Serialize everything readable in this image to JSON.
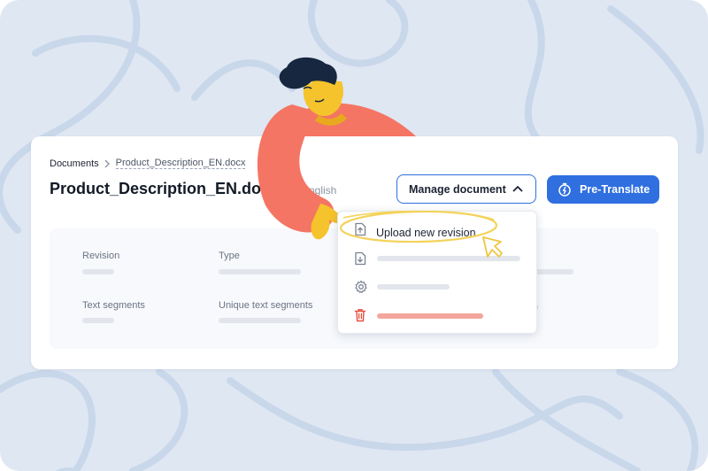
{
  "breadcrumb": {
    "root": "Documents",
    "current": "Product_Description_EN.docx"
  },
  "document": {
    "title": "Product_Description_EN.docx",
    "language": "English"
  },
  "buttons": {
    "manage": "Manage document",
    "pretranslate": "Pre-Translate"
  },
  "fields": [
    {
      "label": "Revision"
    },
    {
      "label": "Type"
    },
    {
      "label": "Text segments"
    },
    {
      "label": "Unique text segments"
    }
  ],
  "menu": {
    "items": [
      {
        "label": "Upload new revision",
        "icon": "upload-file-icon"
      },
      {
        "label": "",
        "icon": "download-file-icon"
      },
      {
        "label": "",
        "icon": "gear-icon"
      },
      {
        "label": "",
        "icon": "trash-icon"
      }
    ]
  },
  "colors": {
    "primary": "#2f6fe0",
    "danger": "#e5503f",
    "highlight": "#f3d35a",
    "background": "#dfe7f3"
  }
}
